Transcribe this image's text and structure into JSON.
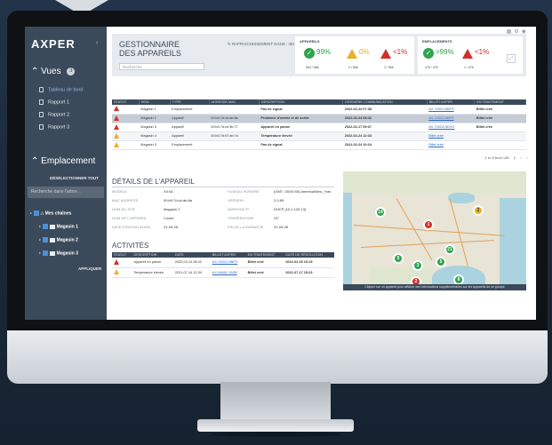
{
  "app": {
    "logo": "AXPER"
  },
  "sidebar": {
    "views_label": "Vues",
    "views_count": "3",
    "items": [
      {
        "label": "Tableau de bord"
      },
      {
        "label": "Rapport 1"
      },
      {
        "label": "Rapport 2"
      },
      {
        "label": "Rapport 3"
      }
    ],
    "location_label": "Emplacement",
    "deselect_all": "DÉSÉLECTIONNER TOUT",
    "tree_search_placeholder": "Recherche dans l'arbre...",
    "tree": [
      {
        "label": "Mes chaînes"
      },
      {
        "label": "Magasin 1"
      },
      {
        "label": "Magasin 2"
      },
      {
        "label": "Magasin 3"
      }
    ],
    "apply": "APPLIQUER"
  },
  "header": {
    "title_line1": "GESTIONNAIRE",
    "title_line2": "DES APPAREILS",
    "search_placeholder": "Recherche",
    "refresh_label": "RAFRAICHISSEMENT DANS : 4M",
    "devices": {
      "title": "APPAREILS",
      "ok_pct": "99%",
      "warn_pct": "0%",
      "err_pct": "<1%",
      "ok_count": "564 / 566",
      "warn_count": "0 / 566",
      "err_count": "2 / 566"
    },
    "locations": {
      "title": "EMPLACEMENTS",
      "ok_pct": ">99%",
      "err_pct": "<1%",
      "ok_count": "475 / 476",
      "err_count": "1 / 476"
    }
  },
  "devices_table": {
    "columns": [
      "STATUT",
      "NOM",
      "TYPE",
      "ADRESSE MAC",
      "DESCRIPTION",
      "DERNIÈRE COMMUNICATION",
      "BILLET AXPER",
      "EN TRAITEMENT"
    ],
    "rows": [
      {
        "status": "red",
        "name": "Magasin 1",
        "type": "Emplacement",
        "mac": "",
        "desc": "Pas de signal",
        "last": "2022-02-24 07:38",
        "ticket": "AX-74321-NBFS",
        "proc": "Billet créé"
      },
      {
        "status": "red",
        "name": "Magasin 2",
        "type": "Appareil",
        "mac": "00:b0:7d:cb:ab:8a",
        "desc": "Problème d'entrée et de sortie",
        "last": "2022-02-24 08:42",
        "ticket": "AX-74322-NBFS",
        "proc": "Billet créé"
      },
      {
        "status": "red",
        "name": "Magasin 3",
        "type": "Appareil",
        "mac": "00:b0:7d:cb:3b:77",
        "desc": "Appareil en panne",
        "last": "2022-02-17 09:07",
        "ticket": "AX-74324-NDVG",
        "proc": "Billet créé"
      },
      {
        "status": "yellow",
        "name": "Magasin 4",
        "type": "Appareil",
        "mac": "00:b0:7d:57:ab:7a",
        "desc": "Température élevée",
        "last": "2022-02-24 12:34",
        "ticket": "Billet créé",
        "proc": ""
      },
      {
        "status": "yellow",
        "name": "Magasin 5",
        "type": "Emplacement",
        "mac": "",
        "desc": "Pas de signal",
        "last": "2022-02-24 10:24",
        "ticket": "Billet créé",
        "proc": ""
      }
    ],
    "pager": "1 to 5 from 136"
  },
  "details": {
    "title": "DÉTAILS DE L'APPAREIL",
    "left": [
      {
        "k": "MODÈLE",
        "v": "XXXA"
      },
      {
        "k": "MAC ADDRESS",
        "v": "00:b0:7d:cb:ab:8a"
      },
      {
        "k": "NOM DU SITE",
        "v": "Magasin 2"
      },
      {
        "k": "NOM DE L'APPAREIL",
        "v": "Cooler"
      },
      {
        "k": "DATE D'INSTALLATION",
        "v": "21-09-28"
      }
    ],
    "right": [
      {
        "k": "FUSEAU HORAIRE",
        "v": "(GMT -05:00:00) America/New_York"
      },
      {
        "k": "VERSION",
        "v": "2.0.89"
      },
      {
        "k": "ADRESSE IP",
        "v": "DHCP (10.1.125.13)"
      },
      {
        "k": "TEMPÉRATURE",
        "v": "23°"
      },
      {
        "k": "FIN DE LA GARANTIE",
        "v": "22-09-28"
      }
    ]
  },
  "activities": {
    "title": "ACTIVITÉS",
    "columns": [
      "STATUT",
      "DESCRIPTION",
      "DATE",
      "BILLET AXPER",
      "EN TRAITEMENT",
      "DATE DE RÉSOLUTION"
    ],
    "rows": [
      {
        "status": "red",
        "desc": "Appareil en panne",
        "date": "2022-02-24 08:42",
        "ticket": "AX-74322-NBFS",
        "proc": "Billet créé",
        "res": "2022-02-25 10:15"
      },
      {
        "status": "yellow",
        "desc": "Température élevée",
        "date": "2021-07-14 12:34",
        "ticket": "AX-54682-YASB",
        "proc": "Billet créé",
        "res": "2021-07-17 15:23"
      }
    ]
  },
  "map": {
    "pins": [
      {
        "label": "14",
        "kind": "g"
      },
      {
        "label": "2",
        "kind": "y"
      },
      {
        "label": "1",
        "kind": "r"
      },
      {
        "label": "21",
        "kind": "g"
      },
      {
        "label": "5",
        "kind": "g"
      },
      {
        "label": "3",
        "kind": "g"
      },
      {
        "label": "5",
        "kind": "g"
      },
      {
        "label": "2",
        "kind": "r"
      },
      {
        "label": "8",
        "kind": "g"
      }
    ],
    "caption": "Cliquez sur un appareil pour afficher des informations supplémentaires sur les appareils de ce groupe"
  }
}
